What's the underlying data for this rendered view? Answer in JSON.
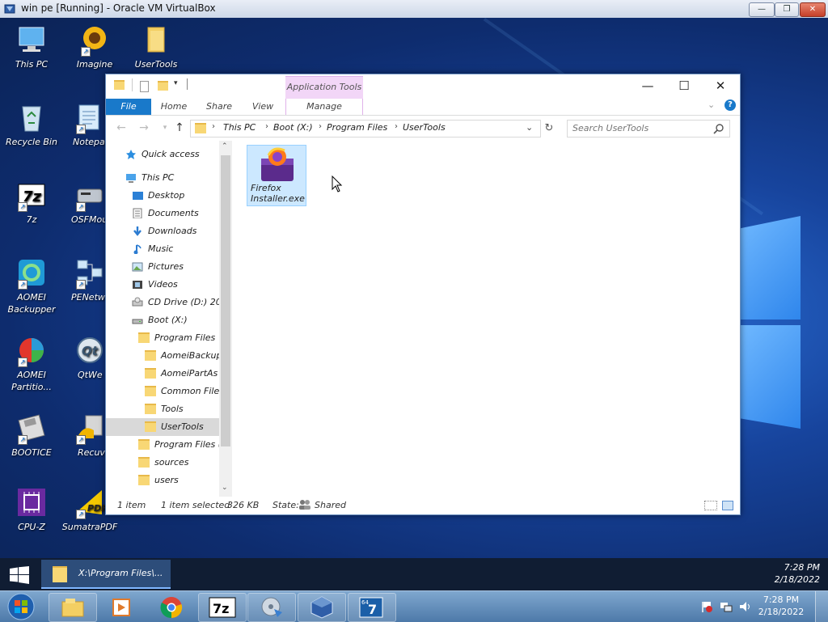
{
  "host_window": {
    "title": "win pe [Running] - Oracle VM VirtualBox",
    "controls": {
      "minimize": "—",
      "restore": "❐",
      "close": "✕"
    }
  },
  "desktop_icons": [
    {
      "label": "This PC",
      "icon": "computer-icon"
    },
    {
      "label": "Imagine",
      "icon": "imagine-icon"
    },
    {
      "label": "UserTools",
      "icon": "folder-icon"
    },
    {
      "label": "Recycle Bin",
      "icon": "recycle-bin-icon"
    },
    {
      "label": "Notepa",
      "icon": "notepad-icon"
    },
    {
      "label": "7z",
      "icon": "7zip-icon"
    },
    {
      "label": "OSFMou",
      "icon": "osfmount-icon"
    },
    {
      "label": "AOMEI Backupper",
      "icon": "aomei-backupper-icon"
    },
    {
      "label": "PENetw",
      "icon": "network-icon"
    },
    {
      "label": "AOMEI Partitio...",
      "icon": "aomei-partition-icon"
    },
    {
      "label": "QtWe",
      "icon": "qt-icon"
    },
    {
      "label": "BOOTICE",
      "icon": "bootice-icon"
    },
    {
      "label": "Recuv",
      "icon": "recuva-icon"
    },
    {
      "label": "CPU-Z",
      "icon": "cpuz-icon"
    },
    {
      "label": "SumatraPDF",
      "icon": "sumatrapdf-icon"
    }
  ],
  "explorer": {
    "contextual_tab": "Application Tools",
    "ribbon_tabs": [
      "File",
      "Home",
      "Share",
      "View",
      "Manage"
    ],
    "address": [
      "This PC",
      "Boot (X:)",
      "Program Files",
      "UserTools"
    ],
    "search_placeholder": "Search UserTools",
    "nav": {
      "quick_access": "Quick access",
      "this_pc": "This PC",
      "desktop": "Desktop",
      "documents": "Documents",
      "downloads": "Downloads",
      "music": "Music",
      "pictures": "Pictures",
      "videos": "Videos",
      "cd_drive": "CD Drive (D:) 20",
      "boot": "Boot (X:)",
      "program_files": "Program Files",
      "aomei_backup": "AomeiBackup",
      "aomei_part": "AomeiPartAs",
      "common_files": "Common Files",
      "tools": "Tools",
      "usertools": "UserTools",
      "program_files_x86": "Program Files (",
      "sources": "sources",
      "users": "users"
    },
    "file": {
      "name_line1": "Firefox",
      "name_line2": "Installer.exe"
    },
    "status": {
      "count": "1 item",
      "selected": "1 item selected",
      "size": "326 KB",
      "state_label": "State:",
      "state_value": "Shared"
    }
  },
  "pe_taskbar": {
    "task_label": "X:\\Program Files\\...",
    "time": "7:28 PM",
    "date": "2/18/2022"
  },
  "win7_taskbar": {
    "apps": [
      "explorer-icon",
      "media-player-icon",
      "chrome-icon",
      "7zip-icon",
      "installer-icon",
      "virtualbox-icon",
      "win7-usb-icon"
    ],
    "time": "7:28 PM",
    "date": "2/18/2022"
  },
  "colors": {
    "accent": "#1979ca",
    "selection": "#cce8ff",
    "folder": "#f8d775"
  }
}
